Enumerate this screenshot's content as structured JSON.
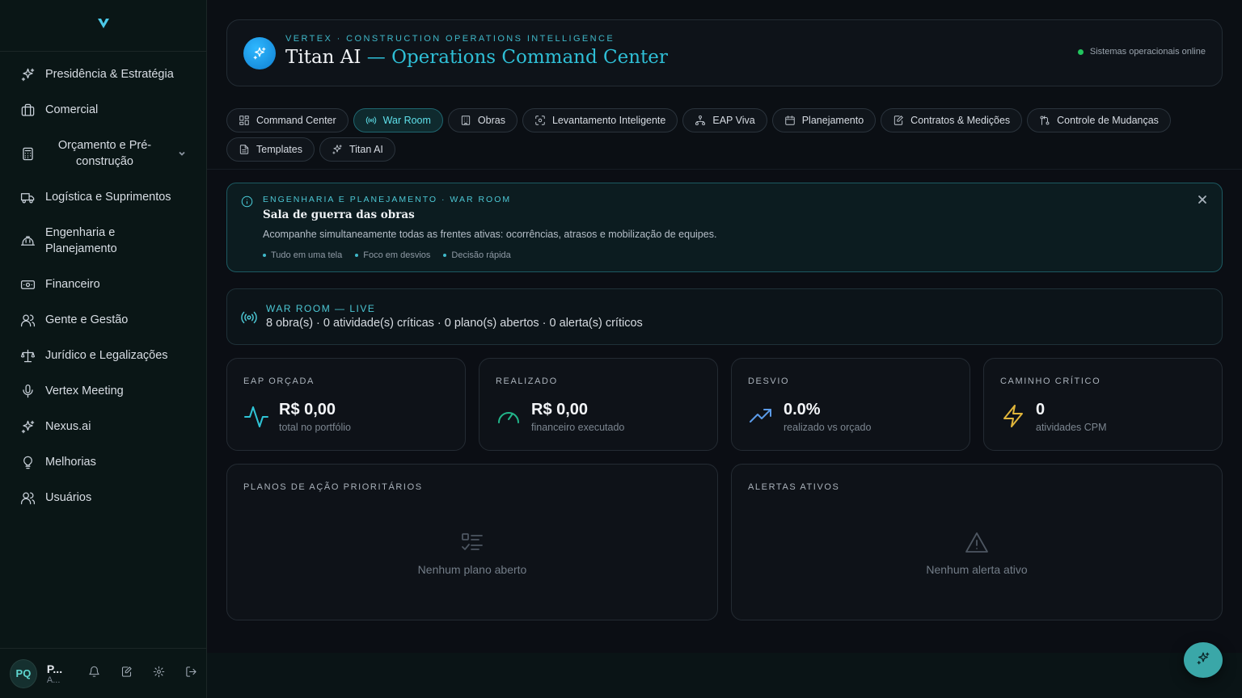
{
  "sidebar": {
    "logo_icon": "vertex-logo-icon",
    "items": [
      {
        "label": "Presidência & Estratégia",
        "icon": "sparkles-icon"
      },
      {
        "label": "Comercial",
        "icon": "briefcase-icon"
      },
      {
        "label": "Orçamento e Pré-construção",
        "icon": "calculator-icon",
        "expandable": true
      },
      {
        "label": "Logística e Suprimentos",
        "icon": "truck-icon"
      },
      {
        "label": "Engenharia e Planejamento",
        "icon": "hardhat-icon"
      },
      {
        "label": "Financeiro",
        "icon": "banknote-icon"
      },
      {
        "label": "Gente e Gestão",
        "icon": "users-icon"
      },
      {
        "label": "Jurídico e Legalizações",
        "icon": "scale-icon"
      },
      {
        "label": "Vertex Meeting",
        "icon": "microphone-icon"
      },
      {
        "label": "Nexus.ai",
        "icon": "sparkles-icon"
      },
      {
        "label": "Melhorias",
        "icon": "lightbulb-icon"
      },
      {
        "label": "Usuários",
        "icon": "users-icon"
      }
    ],
    "user": {
      "initials": "PQ",
      "name": "P...",
      "role": "A..."
    }
  },
  "header": {
    "eyebrow": "VERTEX · CONSTRUCTION OPERATIONS INTELLIGENCE",
    "title_main": "Titan AI",
    "title_accent": " — Operations Command Center",
    "status": "Sistemas operacionais online"
  },
  "tabs": [
    {
      "label": "Command Center",
      "icon": "grid-icon",
      "active": false
    },
    {
      "label": "War Room",
      "icon": "radio-icon",
      "active": true
    },
    {
      "label": "Obras",
      "icon": "building-icon",
      "active": false
    },
    {
      "label": "Levantamento Inteligente",
      "icon": "scan-icon",
      "active": false
    },
    {
      "label": "EAP Viva",
      "icon": "hierarchy-icon",
      "active": false
    },
    {
      "label": "Planejamento",
      "icon": "calendar-icon",
      "active": false
    },
    {
      "label": "Contratos & Medições",
      "icon": "file-edit-icon",
      "active": false
    },
    {
      "label": "Controle de Mudanças",
      "icon": "git-compare-icon",
      "active": false
    },
    {
      "label": "Templates",
      "icon": "file-text-icon",
      "active": false
    },
    {
      "label": "Titan AI",
      "icon": "sparkles-icon",
      "active": false
    }
  ],
  "info": {
    "eyebrow": "ENGENHARIA E PLANEJAMENTO · WAR ROOM",
    "title": "Sala de guerra das obras",
    "description": "Acompanhe simultaneamente todas as frentes ativas: ocorrências, atrasos e mobilização de equipes.",
    "tags": [
      "Tudo em uma tela",
      "Foco em desvios",
      "Decisão rápida"
    ]
  },
  "live": {
    "eyebrow": "WAR ROOM — LIVE",
    "summary": "8 obra(s) · 0 atividade(s) críticas · 0 plano(s) abertos · 0 alerta(s) críticos"
  },
  "kpis": [
    {
      "label": "EAP ORÇADA",
      "value": "R$ 0,00",
      "sub": "total no portfólio",
      "icon": "activity-icon",
      "color": "#2fc4d6"
    },
    {
      "label": "REALIZADO",
      "value": "R$ 0,00",
      "sub": "financeiro executado",
      "icon": "gauge-icon",
      "color": "#22b58a"
    },
    {
      "label": "DESVIO",
      "value": "0.0%",
      "sub": "realizado vs orçado",
      "icon": "trending-up-icon",
      "color": "#5b9be8"
    },
    {
      "label": "CAMINHO CRÍTICO",
      "value": "0",
      "sub": "atividades CPM",
      "icon": "zap-icon",
      "color": "#e0b53a"
    }
  ],
  "panels": [
    {
      "label": "PLANOS DE AÇÃO PRIORITÁRIOS",
      "empty": "Nenhum plano aberto",
      "icon": "list-checks-icon"
    },
    {
      "label": "ALERTAS ATIVOS",
      "empty": "Nenhum alerta ativo",
      "icon": "alert-triangle-icon"
    }
  ],
  "colors": {
    "accent": "#2fbfd6",
    "sidebar_bg": "#0a1616",
    "page_bg": "#0b0e14",
    "status_online": "#22c55e",
    "fab": "#3aa7a8"
  }
}
